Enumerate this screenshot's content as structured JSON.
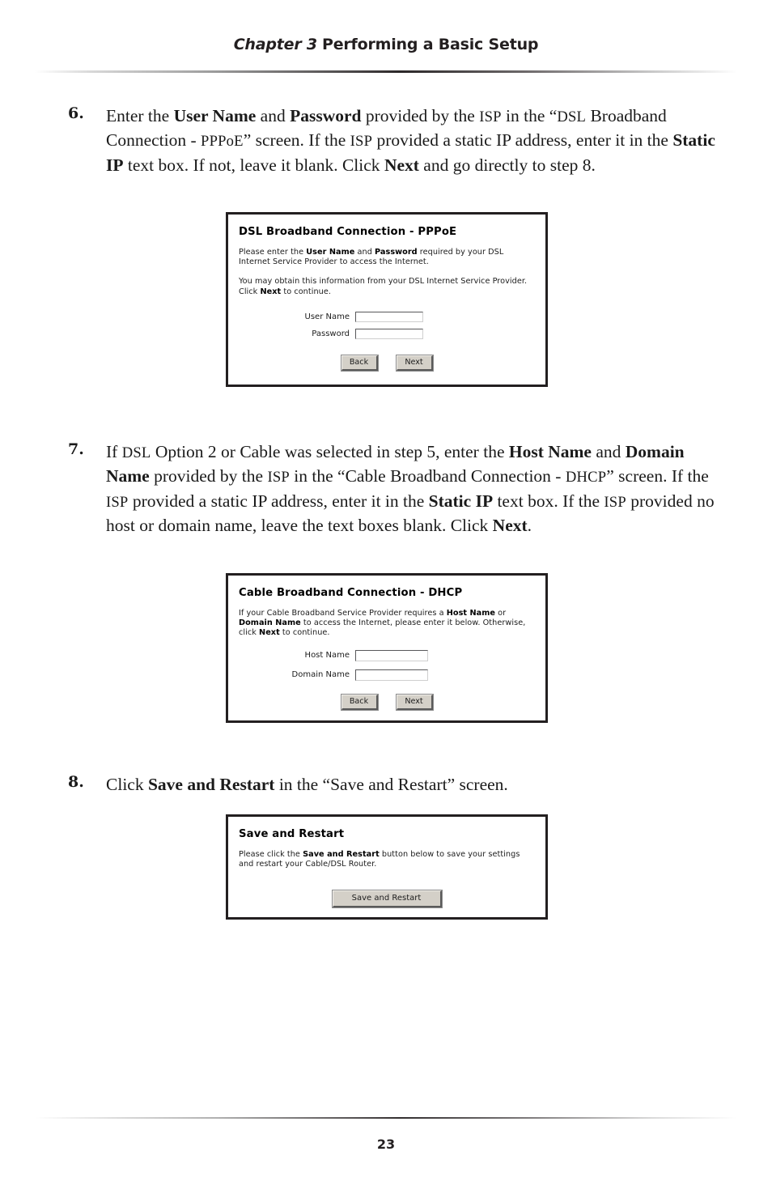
{
  "header": {
    "chapter_label": "Chapter 3",
    "title": "Performing a Basic Setup"
  },
  "footer": {
    "page_number": "23"
  },
  "steps": [
    {
      "number": "6.",
      "text_html": "Enter the <b>User Name</b> and <b>Password</b> provided by the <span class=\"sc\">ISP</span> in the &#8220;<span class=\"sc\">DSL</span> Broadband Connection - <span class=\"sc\">PPPoE</span>&#8221; screen. If the <span class=\"sc\">ISP</span> provided a static IP address, enter it in the <b>Static IP</b> text box. If not, leave it blank. Click <b>Next</b> and go directly to step 8.",
      "plain_text": "Enter the User Name and Password provided by the ISP in the “DSL Broadband Connection - PPPoE” screen. If the ISP provided a static IP address, enter it in the Static IP text box. If not, leave it blank. Click Next and go directly to step 8."
    },
    {
      "number": "7.",
      "text_html": "If <span class=\"sc\">DSL</span> Option 2 or Cable was selected in step 5, enter the <b>Host Name</b> and <b>Domain Name</b> provided by the <span class=\"sc\">ISP</span> in the &#8220;Cable Broadband Connection - <span class=\"sc\">DHCP</span>&#8221; screen. If the <span class=\"sc\">ISP</span> provided a static IP address, enter it in the <b>Static IP</b> text box. If the <span class=\"sc\">ISP</span> provided no host or domain name, leave the text boxes blank. Click <b>Next</b>.",
      "plain_text": "If DSL Option 2 or Cable was selected in step 5, enter the Host Name and Domain Name provided by the ISP in the “Cable Broadband Connection - DHCP” screen. If the ISP provided a static IP address, enter it in the Static IP text box. If the ISP provided no host or domain name, leave the text boxes blank. Click Next."
    },
    {
      "number": "8.",
      "text_html": "Click <b>Save and Restart</b> in the &#8220;Save and Restart&#8221; screen.",
      "plain_text": "Click Save and Restart in the “Save and Restart” screen."
    }
  ],
  "screenshots": {
    "pppoe": {
      "title": "DSL Broadband Connection - PPPoE",
      "paragraph1_html": "Please enter the <b>User Name</b> and <b>Password</b> required by your DSL Internet Service Provider to access the Internet.",
      "paragraph1_text": "Please enter the User Name and Password required by your DSL Internet Service Provider to access the Internet.",
      "paragraph2_html": "You may obtain this information from your DSL Internet Service Provider. Click <b>Next</b> to continue.",
      "paragraph2_text": "You may obtain this information from your DSL Internet Service Provider. Click Next to continue.",
      "fields": [
        {
          "label": "User Name",
          "value": ""
        },
        {
          "label": "Password",
          "value": ""
        }
      ],
      "buttons": [
        {
          "label": "Back"
        },
        {
          "label": "Next"
        }
      ]
    },
    "dhcp": {
      "title": "Cable Broadband Connection - DHCP",
      "paragraph1_html": "If your Cable Broadband Service Provider requires a <b>Host Name</b> or <b>Domain Name</b> to access the Internet, please enter it below. Otherwise, click <b>Next</b> to continue.",
      "paragraph1_text": "If your Cable Broadband Service Provider requires a Host Name or Domain Name to access the Internet, please enter it below. Otherwise, click Next to continue.",
      "fields": [
        {
          "label": "Host Name",
          "value": ""
        },
        {
          "label": "Domain Name",
          "value": ""
        }
      ],
      "buttons": [
        {
          "label": "Back"
        },
        {
          "label": "Next"
        }
      ]
    },
    "save_restart": {
      "title": "Save and Restart",
      "paragraph1_html": "Please click the <b>Save and Restart</b> button below to save your settings and restart your Cable/DSL Router.",
      "paragraph1_text": "Please click the Save and Restart button below to save your settings and restart your Cable/DSL Router.",
      "buttons": [
        {
          "label": "Save and Restart"
        }
      ]
    }
  },
  "colors": {
    "text": "#1a1a1a",
    "rule_dark": "#2b2728",
    "box_border": "#231f20",
    "button_face": "#d4d0c8"
  }
}
